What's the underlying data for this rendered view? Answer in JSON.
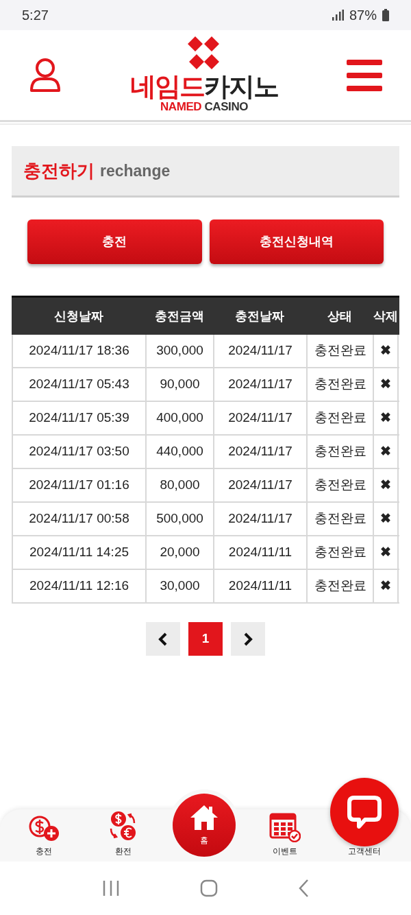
{
  "status_bar": {
    "time": "5:27",
    "battery": "87%"
  },
  "logo": {
    "title_red": "네임드",
    "title_dark": "카지노",
    "sub_red": "NAMED",
    "sub_dark": "CASINO"
  },
  "section": {
    "title": "충전하기",
    "subtitle": "rechange"
  },
  "buttons": [
    {
      "label": "충전"
    },
    {
      "label": "충전신청내역"
    }
  ],
  "table": {
    "columns": [
      "신청날짜",
      "충전금액",
      "충전날짜",
      "상태",
      "삭제"
    ],
    "rows": [
      {
        "requested": "2024/11/17 18:36",
        "amount": "300,000",
        "charged": "2024/11/17",
        "status": "충전완료",
        "delete": "✖"
      },
      {
        "requested": "2024/11/17 05:43",
        "amount": "90,000",
        "charged": "2024/11/17",
        "status": "충전완료",
        "delete": "✖"
      },
      {
        "requested": "2024/11/17 05:39",
        "amount": "400,000",
        "charged": "2024/11/17",
        "status": "충전완료",
        "delete": "✖"
      },
      {
        "requested": "2024/11/17 03:50",
        "amount": "440,000",
        "charged": "2024/11/17",
        "status": "충전완료",
        "delete": "✖"
      },
      {
        "requested": "2024/11/17 01:16",
        "amount": "80,000",
        "charged": "2024/11/17",
        "status": "충전완료",
        "delete": "✖"
      },
      {
        "requested": "2024/11/17 00:58",
        "amount": "500,000",
        "charged": "2024/11/17",
        "status": "충전완료",
        "delete": "✖"
      },
      {
        "requested": "2024/11/11 14:25",
        "amount": "20,000",
        "charged": "2024/11/11",
        "status": "충전완료",
        "delete": "✖"
      },
      {
        "requested": "2024/11/11 12:16",
        "amount": "30,000",
        "charged": "2024/11/11",
        "status": "충전완료",
        "delete": "✖"
      }
    ]
  },
  "pagination": {
    "pages": [
      {
        "label": "1",
        "selected": true
      }
    ]
  },
  "bottom_nav": [
    {
      "kind": "deposit",
      "label": "충전"
    },
    {
      "kind": "exchange",
      "label": "환전"
    },
    {
      "kind": "home",
      "label": "홈"
    },
    {
      "kind": "event",
      "label": "이벤트"
    },
    {
      "kind": "support",
      "label": "고객센터"
    }
  ]
}
